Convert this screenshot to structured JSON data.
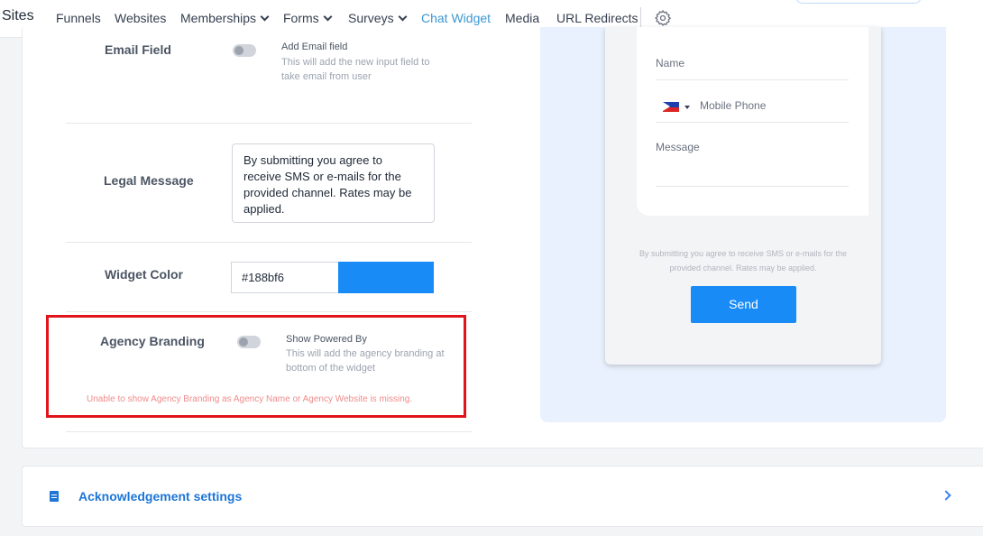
{
  "nav": {
    "brand": "Sites",
    "items": [
      {
        "label": "Funnels",
        "dropdown": false,
        "active": false
      },
      {
        "label": "Websites",
        "dropdown": false,
        "active": false
      },
      {
        "label": "Memberships",
        "dropdown": true,
        "active": false
      },
      {
        "label": "Forms",
        "dropdown": true,
        "active": false
      },
      {
        "label": "Surveys",
        "dropdown": true,
        "active": false
      },
      {
        "label": "Chat Widget",
        "dropdown": false,
        "active": true
      },
      {
        "label": "Media",
        "dropdown": false,
        "active": false
      },
      {
        "label": "URL Redirects",
        "dropdown": false,
        "active": false
      }
    ],
    "settings_icon": "gear-icon"
  },
  "settings": {
    "email_field": {
      "label": "Email Field",
      "toggle_on": false,
      "option_title": "Add Email field",
      "option_desc": "This will add the new input field to take email from user"
    },
    "legal_message": {
      "label": "Legal Message",
      "value": "By submitting you agree to receive SMS or e-mails for the provided channel. Rates may be applied."
    },
    "widget_color": {
      "label": "Widget Color",
      "value": "#188bf6",
      "swatch_color": "#188bf6"
    },
    "agency_branding": {
      "label": "Agency Branding",
      "toggle_on": false,
      "option_title": "Show Powered By",
      "option_desc": "This will add the agency branding at bottom of the widget",
      "warning": "Unable to show Agency Branding as Agency Name or Agency Website is missing."
    }
  },
  "preview": {
    "name_placeholder": "Name",
    "phone_placeholder": "Mobile Phone",
    "message_placeholder": "Message",
    "legal_text": "By submitting you agree to receive SMS or e-mails for the provided channel. Rates may be applied.",
    "send_label": "Send"
  },
  "acknowledgement": {
    "title": "Acknowledgement settings",
    "icon": "receipt-icon",
    "expand_icon": "chevron-right-icon"
  },
  "colors": {
    "accent": "#188bf6",
    "highlight_box": "#e0141a",
    "warning_text": "#f08c8c",
    "active_tab": "#3b97d3"
  }
}
